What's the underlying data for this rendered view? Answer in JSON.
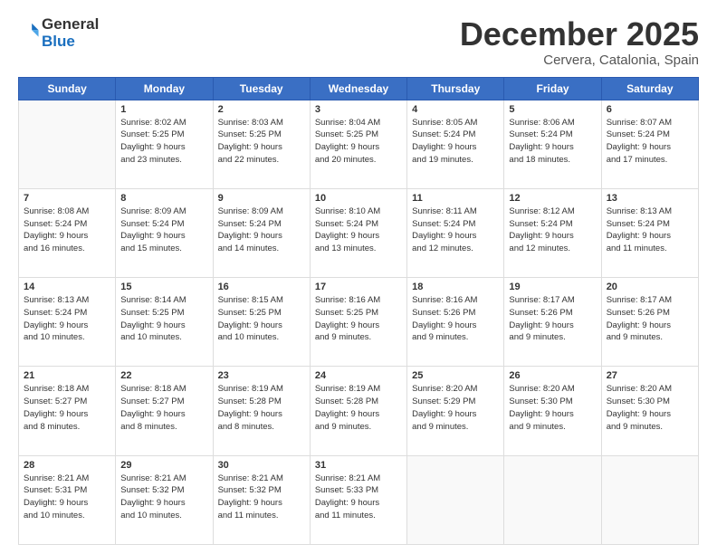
{
  "header": {
    "logo_line1": "General",
    "logo_line2": "Blue",
    "month": "December 2025",
    "location": "Cervera, Catalonia, Spain"
  },
  "weekdays": [
    "Sunday",
    "Monday",
    "Tuesday",
    "Wednesday",
    "Thursday",
    "Friday",
    "Saturday"
  ],
  "weeks": [
    [
      {
        "day": "",
        "info": ""
      },
      {
        "day": "1",
        "info": "Sunrise: 8:02 AM\nSunset: 5:25 PM\nDaylight: 9 hours\nand 23 minutes."
      },
      {
        "day": "2",
        "info": "Sunrise: 8:03 AM\nSunset: 5:25 PM\nDaylight: 9 hours\nand 22 minutes."
      },
      {
        "day": "3",
        "info": "Sunrise: 8:04 AM\nSunset: 5:25 PM\nDaylight: 9 hours\nand 20 minutes."
      },
      {
        "day": "4",
        "info": "Sunrise: 8:05 AM\nSunset: 5:24 PM\nDaylight: 9 hours\nand 19 minutes."
      },
      {
        "day": "5",
        "info": "Sunrise: 8:06 AM\nSunset: 5:24 PM\nDaylight: 9 hours\nand 18 minutes."
      },
      {
        "day": "6",
        "info": "Sunrise: 8:07 AM\nSunset: 5:24 PM\nDaylight: 9 hours\nand 17 minutes."
      }
    ],
    [
      {
        "day": "7",
        "info": "Sunrise: 8:08 AM\nSunset: 5:24 PM\nDaylight: 9 hours\nand 16 minutes."
      },
      {
        "day": "8",
        "info": "Sunrise: 8:09 AM\nSunset: 5:24 PM\nDaylight: 9 hours\nand 15 minutes."
      },
      {
        "day": "9",
        "info": "Sunrise: 8:09 AM\nSunset: 5:24 PM\nDaylight: 9 hours\nand 14 minutes."
      },
      {
        "day": "10",
        "info": "Sunrise: 8:10 AM\nSunset: 5:24 PM\nDaylight: 9 hours\nand 13 minutes."
      },
      {
        "day": "11",
        "info": "Sunrise: 8:11 AM\nSunset: 5:24 PM\nDaylight: 9 hours\nand 12 minutes."
      },
      {
        "day": "12",
        "info": "Sunrise: 8:12 AM\nSunset: 5:24 PM\nDaylight: 9 hours\nand 12 minutes."
      },
      {
        "day": "13",
        "info": "Sunrise: 8:13 AM\nSunset: 5:24 PM\nDaylight: 9 hours\nand 11 minutes."
      }
    ],
    [
      {
        "day": "14",
        "info": "Sunrise: 8:13 AM\nSunset: 5:24 PM\nDaylight: 9 hours\nand 10 minutes."
      },
      {
        "day": "15",
        "info": "Sunrise: 8:14 AM\nSunset: 5:25 PM\nDaylight: 9 hours\nand 10 minutes."
      },
      {
        "day": "16",
        "info": "Sunrise: 8:15 AM\nSunset: 5:25 PM\nDaylight: 9 hours\nand 10 minutes."
      },
      {
        "day": "17",
        "info": "Sunrise: 8:16 AM\nSunset: 5:25 PM\nDaylight: 9 hours\nand 9 minutes."
      },
      {
        "day": "18",
        "info": "Sunrise: 8:16 AM\nSunset: 5:26 PM\nDaylight: 9 hours\nand 9 minutes."
      },
      {
        "day": "19",
        "info": "Sunrise: 8:17 AM\nSunset: 5:26 PM\nDaylight: 9 hours\nand 9 minutes."
      },
      {
        "day": "20",
        "info": "Sunrise: 8:17 AM\nSunset: 5:26 PM\nDaylight: 9 hours\nand 9 minutes."
      }
    ],
    [
      {
        "day": "21",
        "info": "Sunrise: 8:18 AM\nSunset: 5:27 PM\nDaylight: 9 hours\nand 8 minutes."
      },
      {
        "day": "22",
        "info": "Sunrise: 8:18 AM\nSunset: 5:27 PM\nDaylight: 9 hours\nand 8 minutes."
      },
      {
        "day": "23",
        "info": "Sunrise: 8:19 AM\nSunset: 5:28 PM\nDaylight: 9 hours\nand 8 minutes."
      },
      {
        "day": "24",
        "info": "Sunrise: 8:19 AM\nSunset: 5:28 PM\nDaylight: 9 hours\nand 9 minutes."
      },
      {
        "day": "25",
        "info": "Sunrise: 8:20 AM\nSunset: 5:29 PM\nDaylight: 9 hours\nand 9 minutes."
      },
      {
        "day": "26",
        "info": "Sunrise: 8:20 AM\nSunset: 5:30 PM\nDaylight: 9 hours\nand 9 minutes."
      },
      {
        "day": "27",
        "info": "Sunrise: 8:20 AM\nSunset: 5:30 PM\nDaylight: 9 hours\nand 9 minutes."
      }
    ],
    [
      {
        "day": "28",
        "info": "Sunrise: 8:21 AM\nSunset: 5:31 PM\nDaylight: 9 hours\nand 10 minutes."
      },
      {
        "day": "29",
        "info": "Sunrise: 8:21 AM\nSunset: 5:32 PM\nDaylight: 9 hours\nand 10 minutes."
      },
      {
        "day": "30",
        "info": "Sunrise: 8:21 AM\nSunset: 5:32 PM\nDaylight: 9 hours\nand 11 minutes."
      },
      {
        "day": "31",
        "info": "Sunrise: 8:21 AM\nSunset: 5:33 PM\nDaylight: 9 hours\nand 11 minutes."
      },
      {
        "day": "",
        "info": ""
      },
      {
        "day": "",
        "info": ""
      },
      {
        "day": "",
        "info": ""
      }
    ]
  ]
}
